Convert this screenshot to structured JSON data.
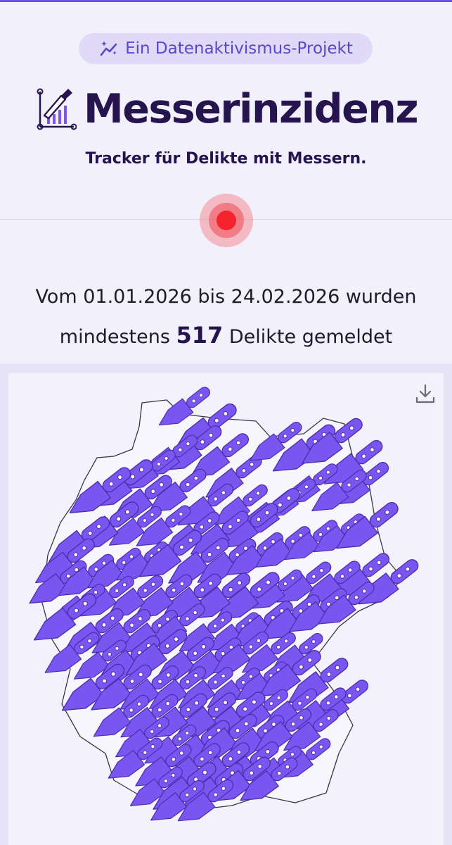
{
  "badge": {
    "label": "Ein Datenaktivismus-Projekt",
    "icon": "sparkle-trend-icon"
  },
  "header": {
    "title": "Messerinzidenz",
    "subtitle": "Tracker für Delikte mit Messern.",
    "logo_icon": "knife-chart-icon",
    "accent_color": "#6c4ee8",
    "title_color": "#26144f"
  },
  "live_indicator": {
    "color": "#f5232e"
  },
  "stats": {
    "prefix": "Vom 01.01.2026 bis 24.02.2026 wurden",
    "min_word": "mindestens",
    "count": "517",
    "suffix": "Delikte gemeldet"
  },
  "map": {
    "download_icon": "download-icon",
    "marker_color": "#7a55f0",
    "marker_icon": "knife-icon"
  }
}
